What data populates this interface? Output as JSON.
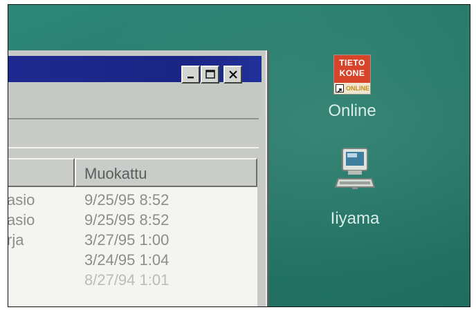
{
  "window": {
    "controls": {
      "minimize_icon": "minimize-icon",
      "maximize_icon": "maximize-icon",
      "close_icon": "close-icon"
    },
    "list": {
      "columns": [
        "",
        "Muokattu"
      ],
      "rows": [
        {
          "type": "asio",
          "modified": "9/25/95 8:52"
        },
        {
          "type": "asio",
          "modified": "9/25/95 8:52"
        },
        {
          "type": "rja",
          "modified": "3/27/95 1:00"
        },
        {
          "type": "",
          "modified": "3/24/95 1:04"
        },
        {
          "type": "",
          "modified": "8/27/94 1:01"
        }
      ]
    }
  },
  "desktop": {
    "icons": [
      {
        "label": "Online",
        "art_text": [
          "TIETO",
          "KONE",
          "ONLINE"
        ],
        "icon": "tietokone-online-icon"
      },
      {
        "label": "Iiyama",
        "icon": "computer-icon"
      }
    ]
  },
  "colors": {
    "desktop": "#257868",
    "titlebar": "#1e2a90",
    "logo_red": "#d8442a"
  }
}
